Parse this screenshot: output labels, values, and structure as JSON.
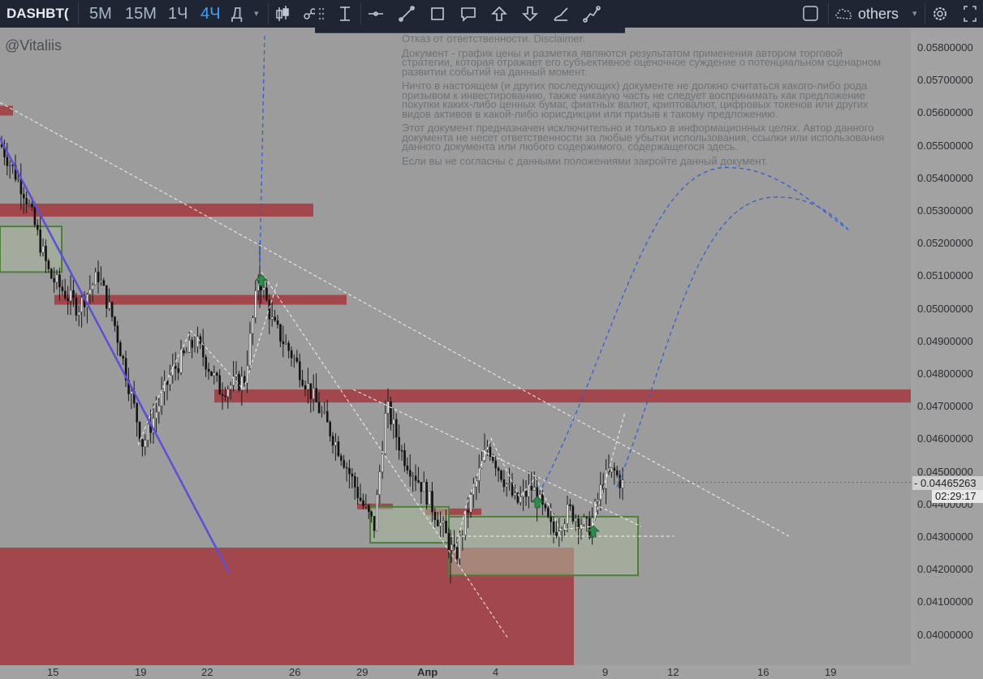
{
  "toolbar": {
    "symbol": "DASHBT(",
    "timeframes": [
      "5M",
      "15M",
      "1Ч",
      "4Ч",
      "Д"
    ],
    "active_timeframe": "4Ч",
    "layout_name": "others",
    "icons": [
      "candles-icon",
      "indicators-icon",
      "drag-handle-icon",
      "cursor-line-icon",
      "horizontal-line-icon",
      "trend-line-icon",
      "rectangle-icon",
      "callout-icon",
      "arrow-up-icon",
      "arrow-down-icon",
      "brush-icon",
      "path-icon",
      "square-icon",
      "cloud-icon",
      "gear-icon",
      "fullscreen-icon"
    ]
  },
  "watermark": "@Vitaliis",
  "disclaimer": [
    "Отказ от ответственности. Disclaimer.",
    "Документ - график цены и разметка являются результатом применения автором торговой стратегии, которая отражает его субъективное оценочное суждение о потенциальном сценарном развитии событий на данный момент.",
    "Ничто в настоящем (и других последующих) документе не должно считаться какого-либо рода призывом к инвестированию, также никакую часть не следует воспринимать как предложение покупки каких-либо ценных бумаг, фиатных валют, криптовалют, цифровых токенов или других видов активов в какой-либо юрисдикции или призыв к такому предложению.",
    "Этот документ предназначен исключительно и только в информационных целях. Автор данного документа не несет ответственности за любые убытки использования, ссылки или использования данного документа или любого содержимого, содержащегося здесь.",
    "Если вы не согласны с данными положениями закройте данный документ."
  ],
  "y_axis": [
    "0.05800000",
    "0.05700000",
    "0.05600000",
    "0.05500000",
    "0.05400000",
    "0.05300000",
    "0.05200000",
    "0.05100000",
    "0.05000000",
    "0.04900000",
    "0.04800000",
    "0.04700000",
    "0.04600000",
    "0.04500000",
    "0.04400000",
    "0.04300000",
    "0.04200000",
    "0.04100000",
    "0.04000000"
  ],
  "x_axis": [
    "15",
    "19",
    "22",
    "26",
    "29",
    "Апр",
    "4",
    "9",
    "12",
    "16",
    "19"
  ],
  "last_price": "0.04465263",
  "countdown": "02:29:17",
  "colors": {
    "toolbar_bg": "#1f2532",
    "chart_bg": "#9c9c9c",
    "zone_red": "#a33a3f",
    "zone_green": "#4e7f3a",
    "forecast_blue": "#2a5bd7",
    "active_tf": "#3da1ff"
  },
  "chart_data": {
    "type": "candlestick",
    "ylim": [
      0.0395,
      0.0584
    ],
    "last_price": 0.04465263,
    "resistance_zones": [
      {
        "from": 0.0559,
        "to": 0.0562
      },
      {
        "from": 0.0528,
        "to": 0.0532
      },
      {
        "from": 0.0501,
        "to": 0.0504
      },
      {
        "from": 0.0471,
        "to": 0.0475
      }
    ],
    "support_zones": [
      {
        "from": 0.0511,
        "to": 0.0525
      },
      {
        "from": 0.0428,
        "to": 0.0439
      },
      {
        "from": 0.0418,
        "to": 0.0436
      }
    ]
  }
}
